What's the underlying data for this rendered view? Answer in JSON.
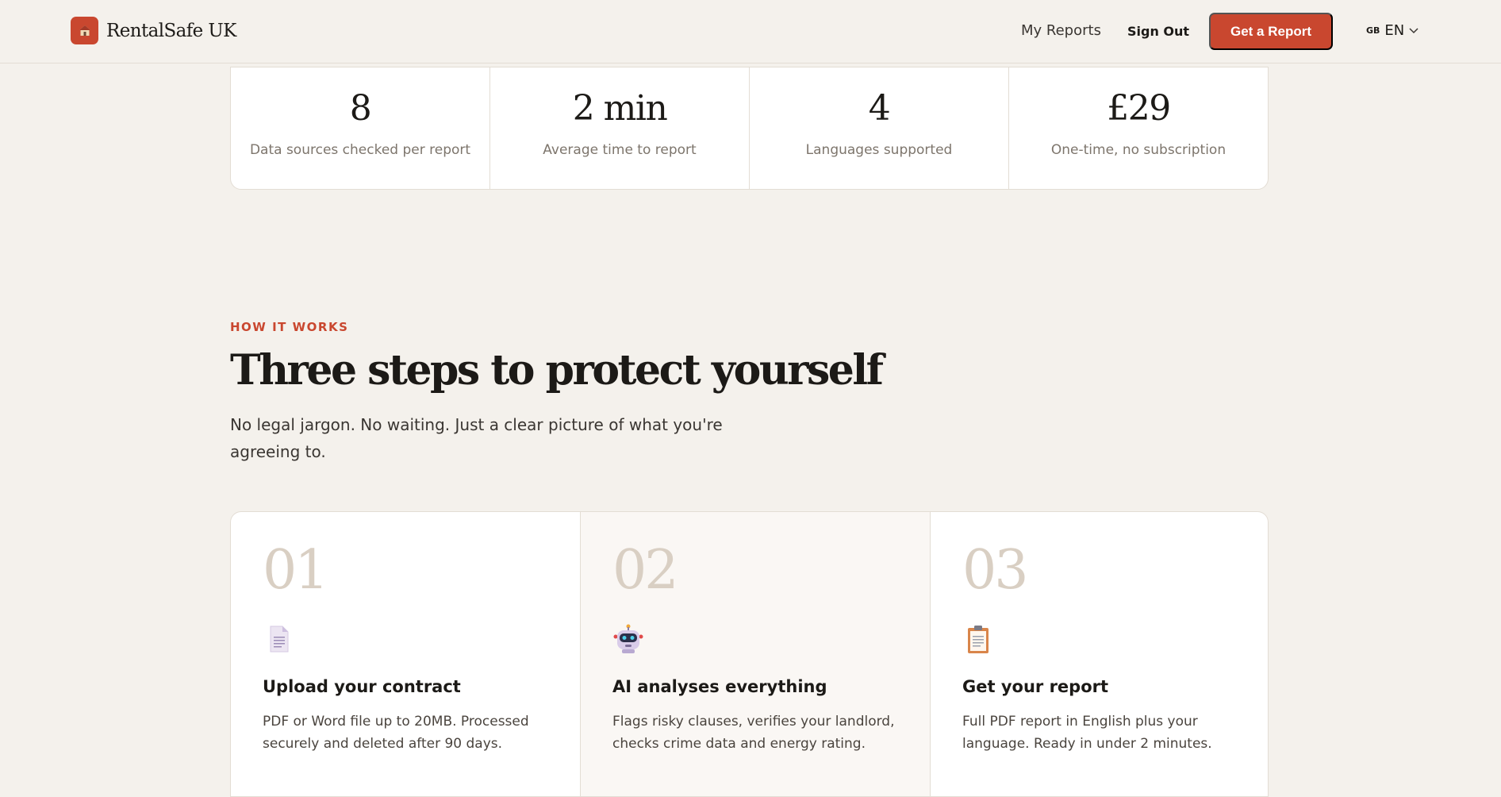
{
  "header": {
    "brand": "RentalSafe UK",
    "nav": {
      "my_reports": "My Reports",
      "sign_out": "Sign Out",
      "cta": "Get a Report"
    },
    "language": {
      "flag": "GB",
      "code": "EN"
    }
  },
  "stats": [
    {
      "value": "8",
      "label": "Data sources checked per report"
    },
    {
      "value": "2 min",
      "label": "Average time to report"
    },
    {
      "value": "4",
      "label": "Languages supported"
    },
    {
      "value": "£29",
      "label": "One-time, no subscription"
    }
  ],
  "how_it_works": {
    "eyebrow": "HOW IT WORKS",
    "headline": "Three steps to protect yourself",
    "subhead": "No legal jargon. No waiting. Just a clear picture of what you're agreeing to."
  },
  "steps": [
    {
      "number": "01",
      "icon": "document-icon",
      "title": "Upload your contract",
      "desc": "PDF or Word file up to 20MB. Processed securely and deleted after 90 days."
    },
    {
      "number": "02",
      "icon": "robot-icon",
      "title": "AI analyses everything",
      "desc": "Flags risky clauses, verifies your landlord, checks crime data and energy rating."
    },
    {
      "number": "03",
      "icon": "clipboard-icon",
      "title": "Get your report",
      "desc": "Full PDF report in English plus your language. Ready in under 2 minutes."
    }
  ],
  "colors": {
    "accent": "#c9472f",
    "background": "#f4f1ec"
  }
}
